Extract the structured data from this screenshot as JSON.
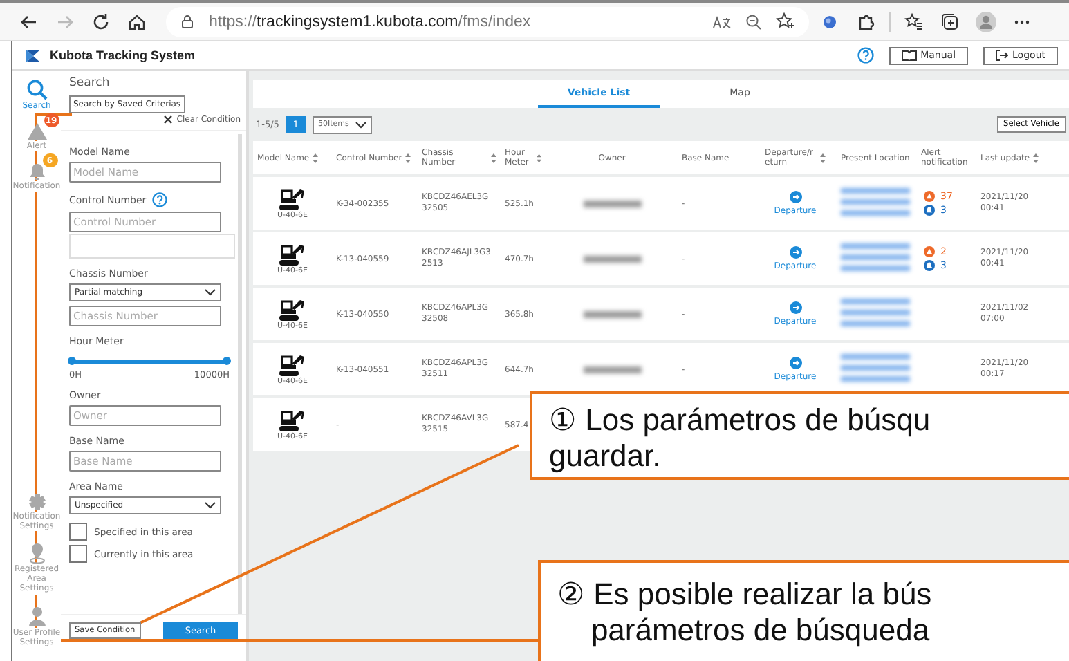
{
  "browser": {
    "url_scheme": "https://",
    "url_host": "trackingsystem1.kubota.com",
    "url_path": "/fms/index",
    "forward_disabled": true
  },
  "app": {
    "title": "Kubota Tracking System",
    "manual": "Manual",
    "logout": "Logout"
  },
  "rail": [
    {
      "label": "Search",
      "kind": "search",
      "selected": true
    },
    {
      "label": "Alert",
      "kind": "alert",
      "badge": "19",
      "selected": false
    },
    {
      "label": "Notification",
      "kind": "notification",
      "badge": "6",
      "selected": false
    },
    {
      "label": "Notification Settings",
      "kind": "settings",
      "selected": false
    },
    {
      "label": "Registered Area Settings",
      "kind": "area",
      "selected": false
    },
    {
      "label": "User Profile Settings",
      "kind": "profile",
      "selected": false
    }
  ],
  "search": {
    "title": "Search",
    "saved_button": "Search by Saved Criterias",
    "clear": "Clear Condition",
    "save_button": "Save Condition",
    "search_button": "Search",
    "fields": [
      {
        "kind": "text",
        "label": "Model Name",
        "placeholder": "Model Name"
      },
      {
        "kind": "text",
        "label": "Control Number",
        "help": true,
        "placeholder": "Control Number"
      },
      {
        "kind": "blank"
      },
      {
        "kind": "select",
        "label": "Chassis Number",
        "value": "Partial matching"
      },
      {
        "kind": "text",
        "placeholder": "Chassis Number"
      },
      {
        "kind": "range",
        "label": "Hour Meter",
        "level": 1,
        "min": "0H",
        "max": "10000H"
      },
      {
        "kind": "text",
        "label": "Owner",
        "placeholder": "Owner"
      },
      {
        "kind": "text",
        "label": "Base Name",
        "placeholder": "Base Name"
      },
      {
        "kind": "select",
        "label": "Area Name",
        "value": "Unspecified"
      },
      {
        "kind": "checkbox",
        "label": "Specified in this area",
        "checked": false
      },
      {
        "kind": "checkbox",
        "label": "Currently in this area",
        "checked": false
      }
    ]
  },
  "tabs": [
    {
      "label": "Vehicle List",
      "selected": true
    },
    {
      "label": "Map",
      "selected": false
    }
  ],
  "pager": {
    "range": "1-5/5",
    "pages": [
      {
        "label": "1",
        "selected": true
      }
    ],
    "per_page": "50Items",
    "select_vehicle": "Select Vehicle"
  },
  "table": {
    "columns": [
      {
        "label": "Model Name",
        "sortable": true
      },
      {
        "label": "Control Number",
        "sortable": true
      },
      {
        "label": "Chassis Number",
        "sortable": true
      },
      {
        "label": "Hour Meter",
        "sortable": true
      },
      {
        "label": "Owner",
        "sortable": false
      },
      {
        "label": "Base Name",
        "sortable": false
      },
      {
        "label": "Departure/return",
        "sortable": true
      },
      {
        "label": "Present Location",
        "sortable": false
      },
      {
        "label": "Alert notification",
        "sortable": false
      },
      {
        "label": "Last update",
        "sortable": true
      }
    ],
    "rows": [
      {
        "model": "U-40-6E",
        "control": "K-34-002355",
        "chassis": "KBCDZ46AEL3G32505",
        "hours": "525.1h",
        "base": "-",
        "departure": "Departure",
        "alerts": [
          {
            "kind": "alert",
            "count": "37"
          },
          {
            "kind": "notification",
            "count": "3"
          }
        ],
        "last_update": "2021/11/20 00:41"
      },
      {
        "model": "U-40-6E",
        "control": "K-13-040559",
        "chassis": "KBCDZ46AJL3G32513",
        "hours": "470.7h",
        "base": "-",
        "departure": "Departure",
        "alerts": [
          {
            "kind": "alert",
            "count": "2"
          },
          {
            "kind": "notification",
            "count": "3"
          }
        ],
        "last_update": "2021/11/20 00:41"
      },
      {
        "model": "U-40-6E",
        "control": "K-13-040550",
        "chassis": "KBCDZ46APL3G32508",
        "hours": "365.8h",
        "base": "-",
        "departure": "Departure",
        "last_update": "2021/11/02 07:00"
      },
      {
        "model": "U-40-6E",
        "control": "K-13-040551",
        "chassis": "KBCDZ46APL3G32511",
        "hours": "644.7h",
        "base": "-",
        "departure": "Departure",
        "last_update": "2021/11/20 00:17"
      },
      {
        "model": "U-40-6E",
        "control": "-",
        "chassis": "KBCDZ46AVL3G32515",
        "hours": "587.4"
      }
    ]
  },
  "callouts": [
    {
      "text": "① Los parámetros de búsqu\nguardar."
    },
    {
      "text": "② Es posible realizar la bús\n    parámetros de búsqueda"
    }
  ]
}
